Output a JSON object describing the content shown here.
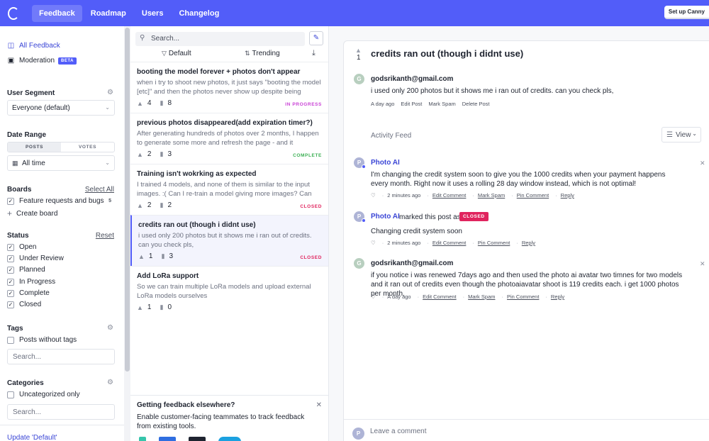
{
  "topbar": {
    "tabs": [
      {
        "label": "Feedback",
        "active": true
      },
      {
        "label": "Roadmap",
        "active": false
      },
      {
        "label": "Users",
        "active": false
      },
      {
        "label": "Changelog",
        "active": false
      }
    ],
    "setup_label": "Set up Canny",
    "accent": "#525df9"
  },
  "sidebar": {
    "all_feedback": "All Feedback",
    "moderation": "Moderation",
    "beta": "BETA",
    "user_segment_title": "User Segment",
    "user_segment_value": "Everyone (default)",
    "date_range_title": "Date Range",
    "date_range_tabs": [
      "POSTS",
      "VOTES"
    ],
    "date_range_value": "All time",
    "boards_title": "Boards",
    "select_all": "Select All",
    "board_name": "Feature requests and bugs",
    "board_count": "5",
    "create_board": "Create board",
    "status_title": "Status",
    "reset": "Reset",
    "statuses": [
      "Open",
      "Under Review",
      "Planned",
      "In Progress",
      "Complete",
      "Closed"
    ],
    "tags_title": "Tags",
    "posts_without_tags": "Posts without tags",
    "tags_search_placeholder": "Search...",
    "categories_title": "Categories",
    "uncategorized_only": "Uncategorized only",
    "categories_search_placeholder": "Search...",
    "update_default": "Update 'Default'"
  },
  "list": {
    "search_placeholder": "Search...",
    "sort_default": "Default",
    "sort_trending": "Trending",
    "posts": [
      {
        "title": "booting the model forever + photos don't appear",
        "desc": "when i try to shoot new photos, it just says \"booting the model [etc]\" and then the photos never show up despite being",
        "votes": "4",
        "comments": "8",
        "status": "IN PROGRESS",
        "status_color": "#c940d6"
      },
      {
        "title": "previous photos disappeared(add expiration timer?)",
        "desc": "After generating hundreds of photos over 2 months, I happen to generate some more and refresh the page - and it",
        "votes": "2",
        "comments": "3",
        "status": "COMPLETE",
        "status_color": "#3cb054"
      },
      {
        "title": "Training isn't wokrking as expected",
        "desc": "I trained 4 models, and none of them is similar to the input images. :( Can I re-train a model giving more images? Can you",
        "votes": "2",
        "comments": "2",
        "status": "CLOSED",
        "status_color": "#e0245e"
      },
      {
        "title": "credits ran out (though i didnt use)",
        "desc": "i used only 200 photos but it shows me i ran out of credits. can you check pls,",
        "votes": "1",
        "comments": "3",
        "status": "CLOSED",
        "status_color": "#e0245e"
      },
      {
        "title": "Add LoRa support",
        "desc": "So we can train multiple LoRa models and upload external LoRa models ourselves",
        "votes": "1",
        "comments": "0",
        "status": "",
        "status_color": "#e0245e"
      }
    ],
    "promo_title": "Getting feedback elsewhere?",
    "promo_text": "Enable customer-facing teammates to track feedback from existing tools."
  },
  "detail": {
    "votes": "1",
    "title": "credits ran out (though i didnt use)",
    "author_initial": "G",
    "author": "godsrikanth@gmail.com",
    "body": "i used only 200 photos but it shows me i ran out of credits. can you check pls,",
    "meta": [
      "A day ago",
      "Edit Post",
      "Mark Spam",
      "Delete Post"
    ],
    "activity_feed": "Activity Feed",
    "view_label": "View",
    "comments": [
      {
        "initial": "P",
        "author": "Photo AI",
        "text": "I'm changing the credit system soon to give you the 1000 credits when your payment happens every month. Right now it uses a rolling 28 day window instead, which is not optimal!",
        "time": "2 minutes ago",
        "actions": [
          "Edit Comment",
          "Mark Spam",
          "Pin Comment",
          "Reply"
        ]
      },
      {
        "initial": "P",
        "author": "Photo AI",
        "marked": "marked this post as",
        "badge": "CLOSED",
        "text": "Changing credit system soon",
        "time": "2 minutes ago",
        "actions": [
          "Edit Comment",
          "Pin Comment",
          "Reply"
        ]
      },
      {
        "initial": "G",
        "author": "godsrikanth@gmail.com",
        "text": "if you notice i was renewed 7days ago and then used the photo ai avatar two timnes for two models and it ran out of credits even though the photoaiavatar shoot is 119 credits each. i get 1000 photos per month.",
        "time": "A day ago",
        "actions": [
          "Edit Comment",
          "Mark Spam",
          "Pin Comment",
          "Reply"
        ]
      }
    ],
    "comment_initial": "P",
    "comment_placeholder": "Leave a comment"
  }
}
